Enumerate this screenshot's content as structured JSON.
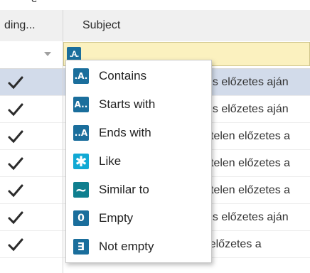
{
  "top_partial_text": "e",
  "header": {
    "col1_label": "ding...",
    "col2_label": "Subject"
  },
  "filter": {
    "operator_icon": "contains-icon",
    "value": ""
  },
  "rows": [
    {
      "checked": true,
      "subject": "es előzetes aján"
    },
    {
      "checked": true,
      "subject": "es előzetes aján"
    },
    {
      "checked": true,
      "subject": "telen előzetes a"
    },
    {
      "checked": true,
      "subject": "telen előzetes a"
    },
    {
      "checked": true,
      "subject": "telen előzetes a"
    },
    {
      "checked": true,
      "subject": "es előzetes aján"
    },
    {
      "checked": true,
      "subject": "[TEST] Értesítés sikertelen előzetes a"
    }
  ],
  "menu": {
    "items": [
      {
        "label": "Contains",
        "icon": "contains-icon",
        "glyph": ".A."
      },
      {
        "label": "Starts with",
        "icon": "starts-with-icon",
        "glyph": "A.."
      },
      {
        "label": "Ends with",
        "icon": "ends-with-icon",
        "glyph": "..A"
      },
      {
        "label": "Like",
        "icon": "like-icon",
        "glyph": "✱"
      },
      {
        "label": "Similar to",
        "icon": "similar-to-icon",
        "glyph": "∼"
      },
      {
        "label": "Empty",
        "icon": "empty-icon",
        "glyph": "0"
      },
      {
        "label": "Not empty",
        "icon": "not-empty-icon",
        "glyph": "∃"
      }
    ]
  },
  "colors": {
    "accent": "#1a6e9c",
    "filter_bg": "#fbf1bf",
    "selected_row": "#d2dbea"
  }
}
